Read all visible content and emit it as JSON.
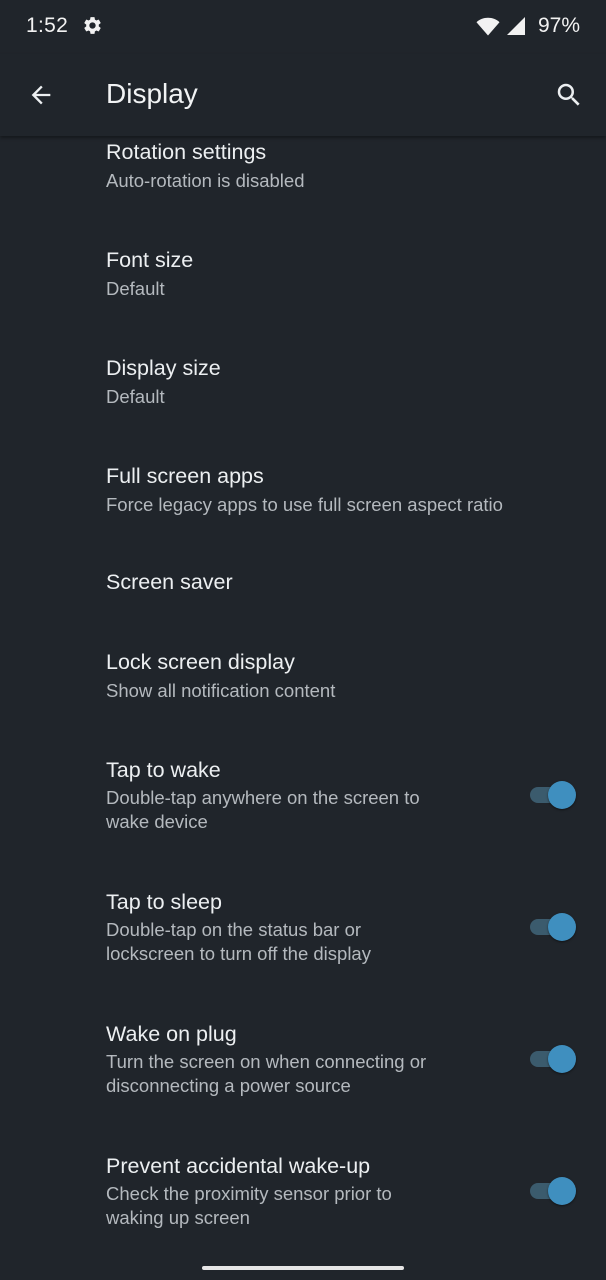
{
  "status_bar": {
    "time": "1:52",
    "battery": "97%",
    "icons": [
      "gear-icon",
      "wifi-icon",
      "cell-signal-icon"
    ]
  },
  "app_bar": {
    "title": "Display",
    "icons": [
      "back-arrow-icon",
      "search-icon"
    ]
  },
  "settings": [
    {
      "title": "Rotation settings",
      "subtitle": "Auto-rotation is disabled"
    },
    {
      "title": "Font size",
      "subtitle": "Default"
    },
    {
      "title": "Display size",
      "subtitle": "Default"
    },
    {
      "title": "Full screen apps",
      "subtitle": "Force legacy apps to use full screen aspect ratio"
    },
    {
      "title": "Screen saver"
    },
    {
      "title": "Lock screen display",
      "subtitle": "Show all notification content"
    },
    {
      "title": "Tap to wake",
      "subtitle_lines": [
        "Double-tap anywhere on the screen to",
        "wake device"
      ],
      "toggle": true
    },
    {
      "title": "Tap to sleep",
      "subtitle_lines": [
        "Double-tap on the status bar or",
        "lockscreen to turn off the display"
      ],
      "toggle": true
    },
    {
      "title": "Wake on plug",
      "subtitle_lines": [
        "Turn the screen on when connecting or",
        "disconnecting a power source"
      ],
      "toggle": true
    },
    {
      "title": "Prevent accidental wake-up",
      "subtitle_lines": [
        "Check the proximity sensor prior to",
        "waking up screen"
      ],
      "toggle": true
    }
  ],
  "colors": {
    "background": "#20252b",
    "toggle_on_thumb": "#3f8fbf",
    "toggle_on_track": "#3b5b6d"
  }
}
